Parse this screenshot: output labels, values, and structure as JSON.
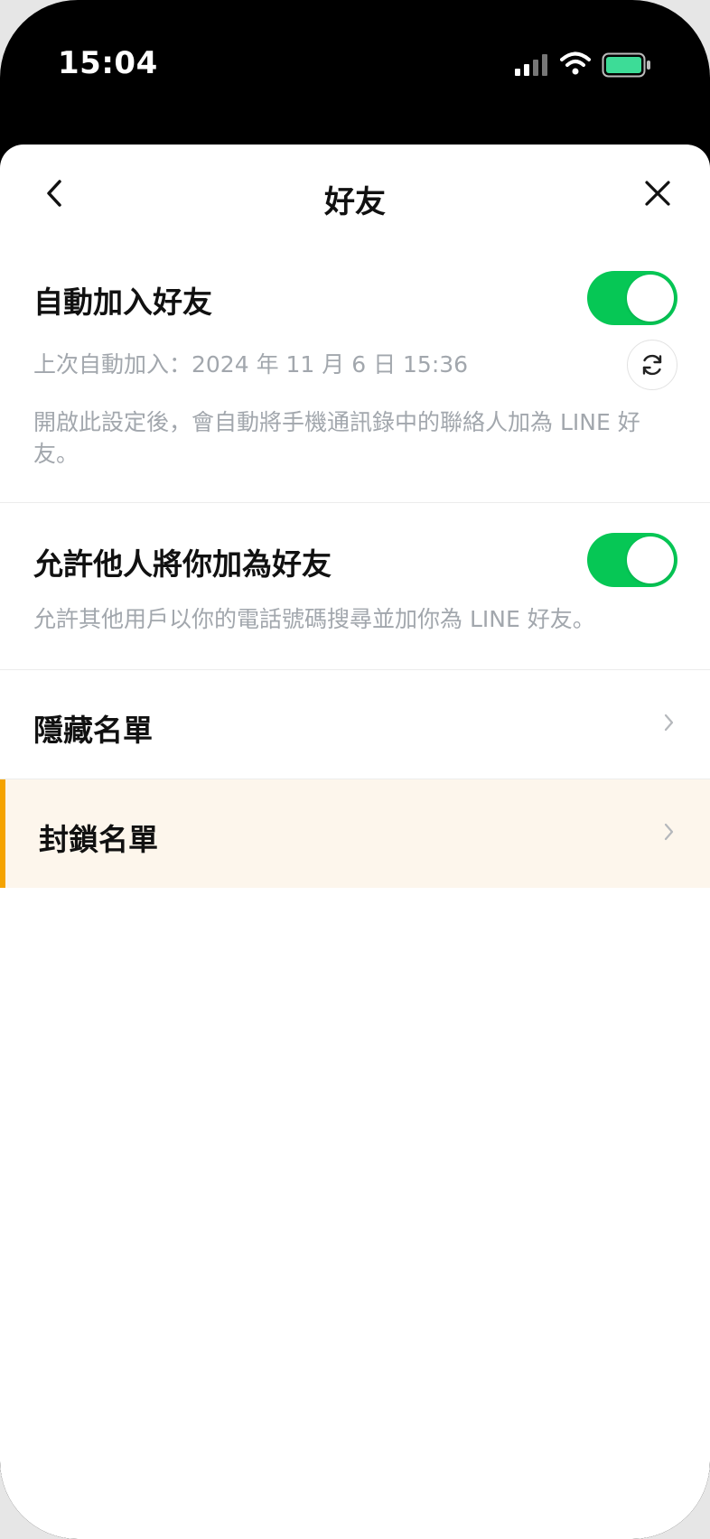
{
  "status_bar": {
    "time": "15:04"
  },
  "nav": {
    "title": "好友"
  },
  "auto_add": {
    "title": "自動加入好友",
    "enabled": true,
    "last_added": "上次自動加入：2024 年 11 月 6 日 15:36",
    "description": "開啟此設定後，會自動將手機通訊錄中的聯絡人加為 LINE 好友。"
  },
  "allow_add": {
    "title": "允許他人將你加為好友",
    "enabled": true,
    "description": "允許其他用戶以你的電話號碼搜尋並加你為 LINE 好友。"
  },
  "list": [
    {
      "label": "隱藏名單"
    },
    {
      "label": "封鎖名單"
    }
  ],
  "colors": {
    "toggle_on": "#06c755",
    "accent": "#f5a300",
    "battery": "#3ddc97"
  }
}
